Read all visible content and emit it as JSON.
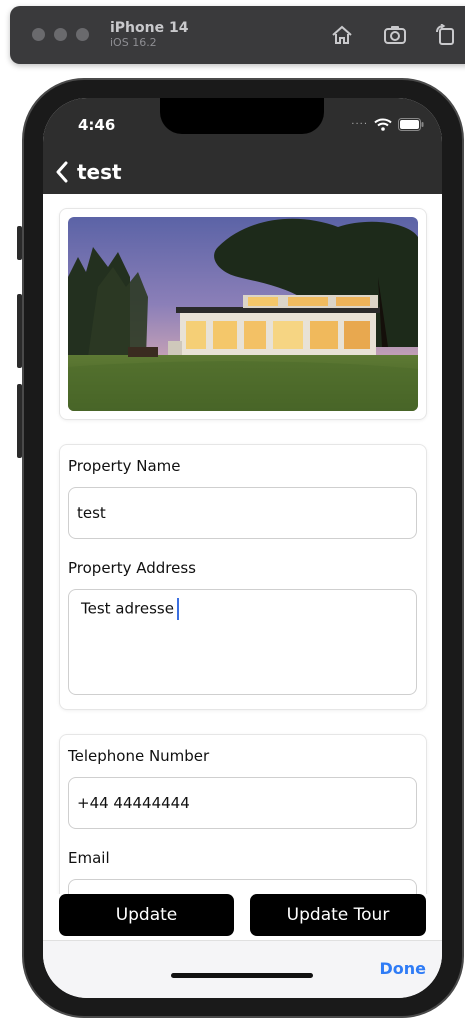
{
  "simulator": {
    "device_name": "iPhone 14",
    "os_version": "iOS 16.2"
  },
  "status_bar": {
    "time": "4:46"
  },
  "nav": {
    "title": "test"
  },
  "form": {
    "property_name_label": "Property Name",
    "property_name_value": "test",
    "property_address_label": "Property Address",
    "property_address_value": "Test adresse",
    "telephone_label": "Telephone Number",
    "telephone_value": "+44 44444444",
    "email_label": "Email",
    "email_value": ""
  },
  "actions": {
    "update_label": "Update",
    "update_tour_label": "Update Tour"
  },
  "keyboard_toolbar": {
    "done_label": "Done"
  },
  "colors": {
    "accent": "#2f7cf6",
    "nav_background": "#2e2e2e",
    "button_background": "#000000"
  },
  "icons": [
    "home-icon",
    "screenshot-icon",
    "rotate-icon",
    "wifi-icon",
    "battery-icon",
    "chevron-left-icon"
  ]
}
